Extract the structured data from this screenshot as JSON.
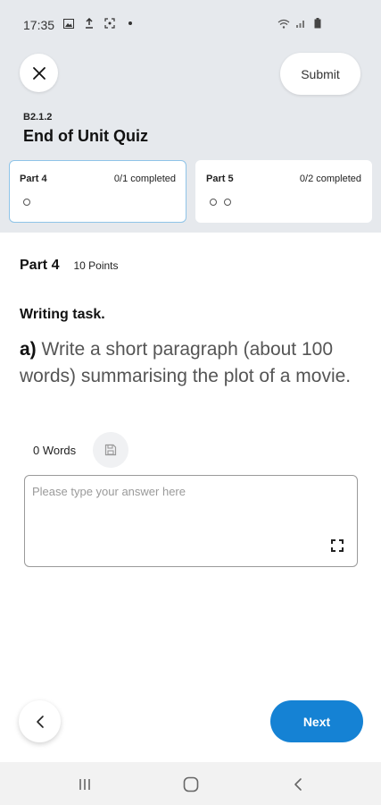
{
  "status_bar": {
    "time": "17:35",
    "left_icons": [
      "image-icon",
      "upload-icon",
      "screenshot-icon",
      "dot-icon"
    ],
    "right_icons": [
      "wifi-icon",
      "signal-icon",
      "battery-icon"
    ]
  },
  "header": {
    "unit_code": "B2.1.2",
    "title": "End of Unit Quiz",
    "submit_label": "Submit"
  },
  "part_tabs": [
    {
      "name": "Part 4",
      "progress": "0/1 completed",
      "total": 1,
      "done": 0,
      "active": true
    },
    {
      "name": "Part 5",
      "progress": "0/2 completed",
      "total": 2,
      "done": 0,
      "active": false
    }
  ],
  "section": {
    "part_label": "Part 4",
    "points": "10 Points",
    "task_title": "Writing task.",
    "question_label": "a)",
    "question_text": "Write a short paragraph (about 100 words) summarising the plot of a movie."
  },
  "answer": {
    "word_count": "0 Words",
    "value": "",
    "placeholder": "Please type your answer here"
  },
  "footer": {
    "next_label": "Next"
  },
  "colors": {
    "header_bg": "#e6e9ed",
    "accent": "#1582d4",
    "active_tab_border": "#8fc4e8"
  }
}
